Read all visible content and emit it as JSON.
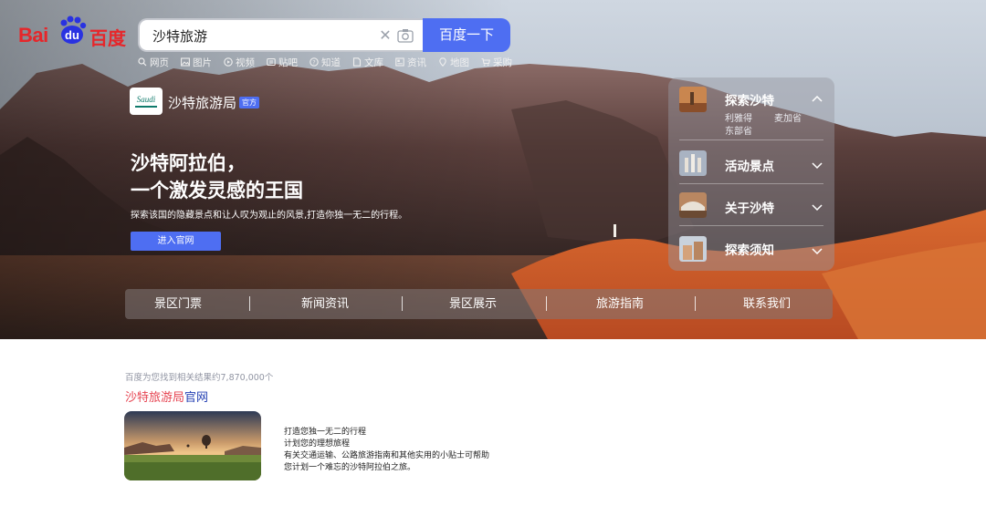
{
  "logo": {
    "bai": "Bai",
    "du": "du",
    "cn": "百度"
  },
  "search": {
    "query": "沙特旅游",
    "button_label": "百度一下"
  },
  "nav_tabs": [
    {
      "label": "网页",
      "icon": "search-icon"
    },
    {
      "label": "图片",
      "icon": "image-icon"
    },
    {
      "label": "视频",
      "icon": "video-icon"
    },
    {
      "label": "贴吧",
      "icon": "tieba-icon"
    },
    {
      "label": "知道",
      "icon": "question-icon"
    },
    {
      "label": "文库",
      "icon": "doc-icon"
    },
    {
      "label": "资讯",
      "icon": "news-icon"
    },
    {
      "label": "地图",
      "icon": "map-icon"
    },
    {
      "label": "采购",
      "icon": "cart-icon"
    }
  ],
  "brand": {
    "name": "沙特旅游局",
    "badge": "官方",
    "logo_text": "Saudi"
  },
  "hero": {
    "headline_line1": "沙特阿拉伯，",
    "headline_line2": "一个激发灵感的王国",
    "subline": "探索该国的隐藏景点和让人叹为观止的风景,打造你独一无二的行程。",
    "enter_button": "进入官网"
  },
  "side_panel": {
    "items": [
      {
        "title": "探索沙特",
        "expanded": true,
        "subs": [
          "利雅得",
          "麦加省",
          "东部省"
        ]
      },
      {
        "title": "活动景点",
        "expanded": false
      },
      {
        "title": "关于沙特",
        "expanded": false
      },
      {
        "title": "探索须知",
        "expanded": false
      }
    ]
  },
  "bottom_nav": [
    "景区门票",
    "新闻资讯",
    "景区展示",
    "旅游指南",
    "联系我们"
  ],
  "result": {
    "count_text": "百度为您找到相关结果约7,870,000个",
    "title_highlight": "沙特旅游局",
    "title_rest": "官网",
    "desc_lines": [
      "打造您独一无二的行程",
      "计划您的理想旅程",
      "有关交通运输、公路旅游指南和其他实用的小贴士可帮助",
      "您计划一个难忘的沙特阿拉伯之旅。"
    ]
  },
  "colors": {
    "accent": "#4e6ef2",
    "baidu_red": "#e6262a",
    "link": "#2440b3",
    "highlight": "#e64552"
  }
}
